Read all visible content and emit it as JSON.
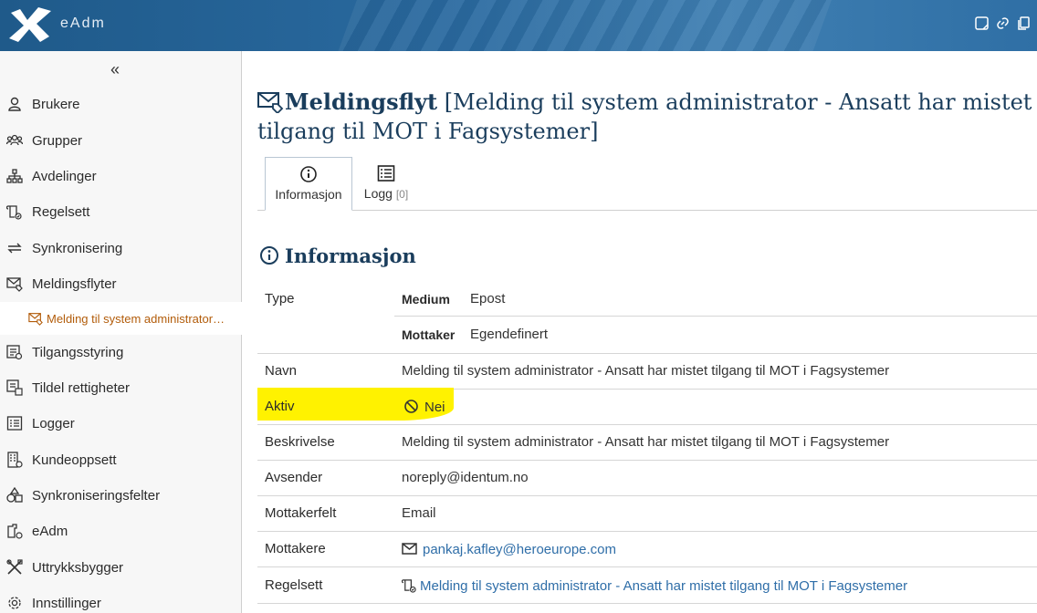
{
  "app": {
    "brand": "eAdm"
  },
  "sidebar": {
    "collapse_label": "«",
    "items": [
      {
        "label": "Brukere",
        "icon": "user-icon"
      },
      {
        "label": "Grupper",
        "icon": "group-icon"
      },
      {
        "label": "Avdelinger",
        "icon": "org-chart-icon"
      },
      {
        "label": "Regelsett",
        "icon": "ruleset-icon"
      },
      {
        "label": "Synkronisering",
        "icon": "sync-icon"
      },
      {
        "label": "Meldingsflyter",
        "icon": "message-flow-icon"
      },
      {
        "label": "Tilgangsstyring",
        "icon": "access-icon"
      },
      {
        "label": "Tildel rettigheter",
        "icon": "assign-rights-icon"
      },
      {
        "label": "Logger",
        "icon": "log-icon"
      },
      {
        "label": "Kundeoppsett",
        "icon": "building-icon"
      },
      {
        "label": "Synkroniseringsfelter",
        "icon": "shapes-icon"
      },
      {
        "label": "eAdm",
        "icon": "eadm-icon"
      },
      {
        "label": "Uttrykksbygger",
        "icon": "tools-icon"
      },
      {
        "label": "Innstillinger",
        "icon": "gear-icon"
      }
    ],
    "active_sub": {
      "label": "Melding til system administrator…",
      "icon": "message-flow-icon"
    }
  },
  "header": {
    "title_bold": "Meldingsflyt",
    "title_rest": "[Melding til system administrator - Ansatt har mistet tilgang til MOT i Fagsystemer]"
  },
  "tabs": [
    {
      "label": "Informasjon",
      "icon": "info-icon",
      "active": true
    },
    {
      "label": "Logg",
      "count": "[0]",
      "icon": "list-icon",
      "active": false
    }
  ],
  "section": {
    "title": "Informasjon"
  },
  "details": {
    "type_label": "Type",
    "medium_label": "Medium",
    "medium_value": "Epost",
    "mottaker_label": "Mottaker",
    "mottaker_value": "Egendefinert",
    "navn_label": "Navn",
    "navn_value": "Melding til system administrator - Ansatt har mistet tilgang til MOT i Fagsystemer",
    "aktiv_label": "Aktiv",
    "aktiv_value": "Nei",
    "beskrivelse_label": "Beskrivelse",
    "beskrivelse_value": "Melding til system administrator - Ansatt har mistet tilgang til MOT i Fagsystemer",
    "avsender_label": "Avsender",
    "avsender_value": "noreply@identum.no",
    "mottakerfelt_label": "Mottakerfelt",
    "mottakerfelt_value": "Email",
    "mottakere_label": "Mottakere",
    "mottakere_value": "pankaj.kafley@heroeurope.com",
    "regelsett_label": "Regelsett",
    "regelsett_value": "Melding til system administrator - Ansatt har mistet tilgang til MOT i Fagsystemer"
  },
  "colors": {
    "highlight": "#fff200",
    "link": "#2f6ea8",
    "title": "#1a3d5c",
    "active_sub": "#b25c0a"
  }
}
